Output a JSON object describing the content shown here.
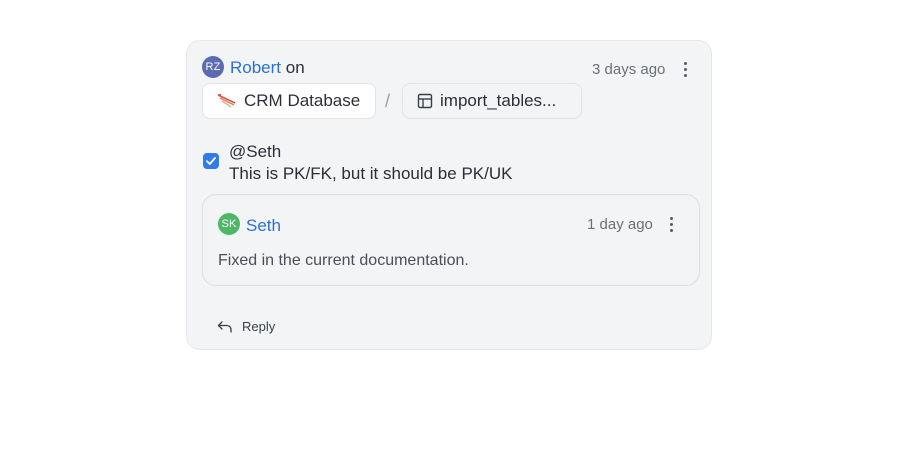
{
  "comment": {
    "author_initials": "RZ",
    "author_name": "Robert",
    "on_text": "on",
    "time": "3 days ago",
    "database_chip": "CRM Database",
    "separator": "/",
    "table_chip": "import_tables...",
    "checked": true,
    "mention": "@Seth",
    "message": "This is PK/FK, but it should be PK/UK"
  },
  "reply": {
    "author_initials": "SK",
    "author_name": "Seth",
    "time": "1 day ago",
    "message": "Fixed in the current documentation."
  },
  "actions": {
    "reply_label": "Reply"
  },
  "colors": {
    "link": "#2a6fd6",
    "avatar_rz": "#5a6bb4",
    "avatar_sk": "#4fb867",
    "checkbox": "#2f7be8",
    "card_bg": "#f3f4f6"
  },
  "icons": {
    "database": "oracle-db-icon",
    "table": "table-icon",
    "more": "more-vertical-icon",
    "reply": "reply-arrow-icon",
    "check": "check-icon"
  }
}
